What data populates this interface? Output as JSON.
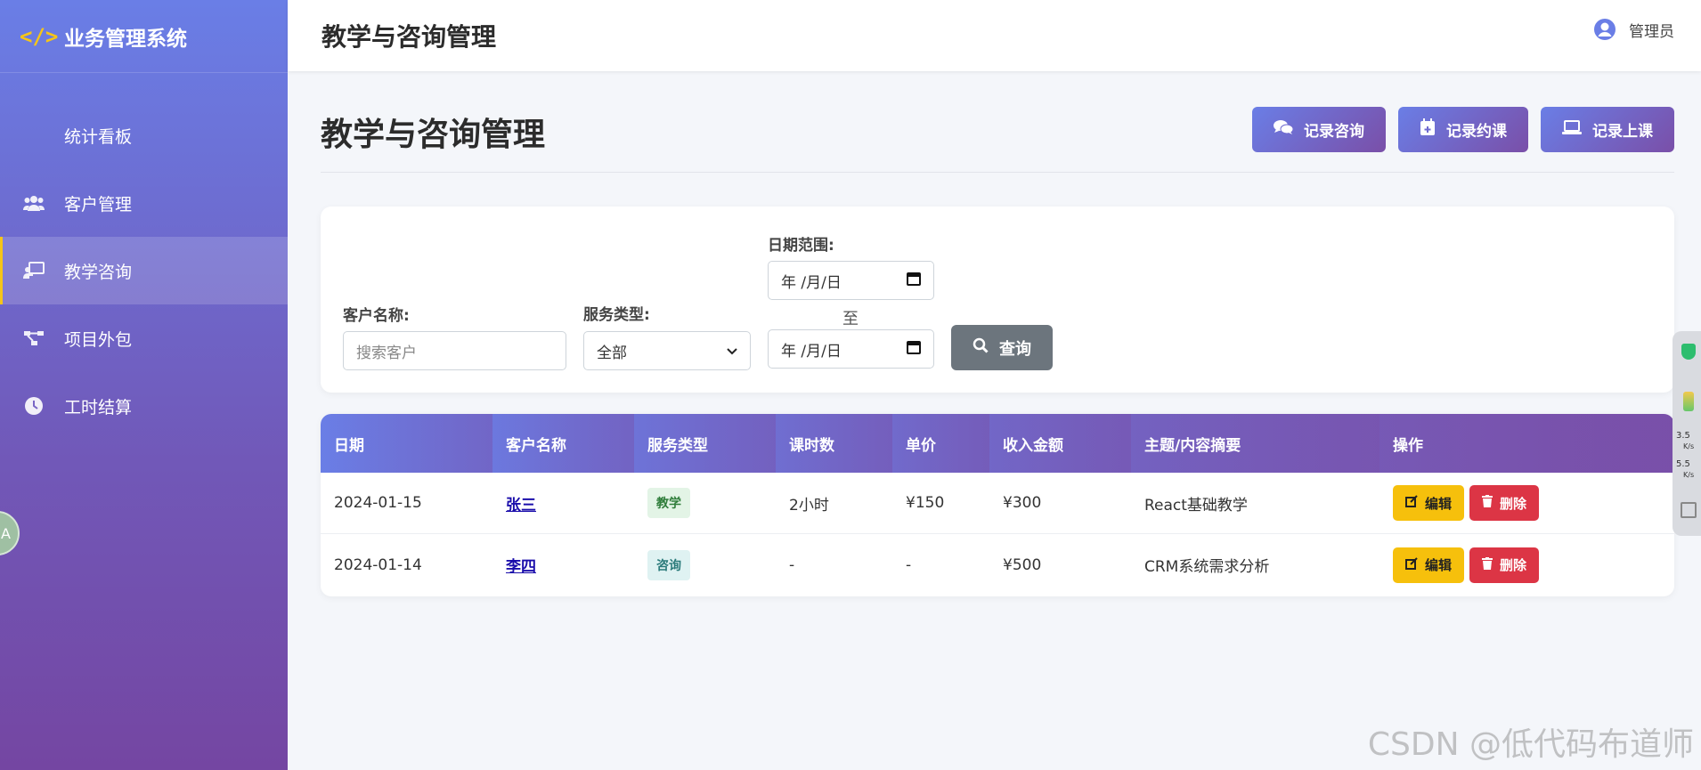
{
  "app": {
    "brand_icon": "</>",
    "brand_title": "业务管理系统"
  },
  "sidebar": {
    "items": [
      {
        "label": "统计看板",
        "icon": "none",
        "active": false
      },
      {
        "label": "客户管理",
        "icon": "users-icon",
        "active": false
      },
      {
        "label": "教学咨询",
        "icon": "chalkboard-teacher-icon",
        "active": true
      },
      {
        "label": "项目外包",
        "icon": "project-diagram-icon",
        "active": false
      },
      {
        "label": "工时结算",
        "icon": "clock-icon",
        "active": false
      }
    ],
    "float_text": "A"
  },
  "header": {
    "title": "教学与咨询管理",
    "user": "管理员"
  },
  "main": {
    "title": "教学与咨询管理",
    "actions": [
      {
        "label": "记录咨询",
        "icon": "comments-icon"
      },
      {
        "label": "记录约课",
        "icon": "calendar-plus-icon"
      },
      {
        "label": "记录上课",
        "icon": "laptop-icon"
      }
    ]
  },
  "filters": {
    "customer_label": "客户名称:",
    "customer_placeholder": "搜索客户",
    "service_label": "服务类型:",
    "service_value": "全部",
    "date_label": "日期范围:",
    "date_from": "年 /月/日",
    "date_to": "年 /月/日",
    "to_label": "至",
    "query_label": "查询"
  },
  "table": {
    "columns": [
      "日期",
      "客户名称",
      "服务类型",
      "课时数",
      "单价",
      "收入金额",
      "主题/内容摘要",
      "操作"
    ],
    "rows": [
      {
        "date": "2024-01-15",
        "customer": "张三",
        "type": "教学",
        "hours": "2小时",
        "price": "¥150",
        "income": "¥300",
        "summary": "React基础教学"
      },
      {
        "date": "2024-01-14",
        "customer": "李四",
        "type": "咨询",
        "hours": "-",
        "price": "-",
        "income": "¥500",
        "summary": "CRM系统需求分析"
      }
    ],
    "edit_label": "编辑",
    "delete_label": "删除"
  },
  "side_widget": {
    "upload": "3.5",
    "download": "5.5",
    "unit": "K/s"
  },
  "watermark": "CSDN @低代码布道师",
  "colors": {
    "accent_start": "#6a7ee6",
    "accent_end": "#7a4fa8",
    "warning": "#f6c00c",
    "danger": "#dc3545",
    "secondary": "#6c757d"
  }
}
